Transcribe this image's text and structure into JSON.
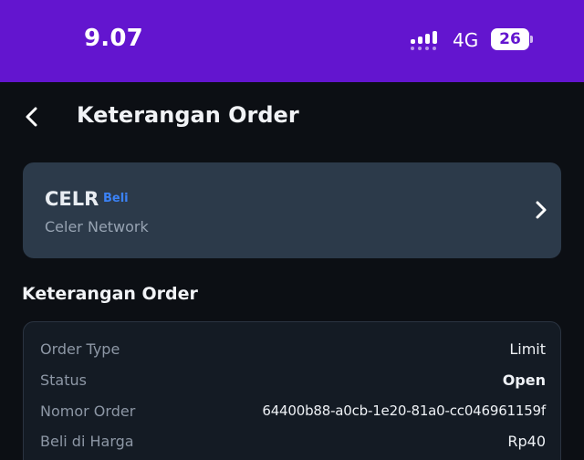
{
  "status_bar": {
    "time": "9.07",
    "network": "4G",
    "battery": "26",
    "background_color": "#6315cf"
  },
  "header": {
    "back_icon": "chevron-left-icon",
    "title": "Keterangan Order"
  },
  "asset": {
    "symbol": "CELR",
    "side": "Beli",
    "side_color": "#3b82f6",
    "name": "Celer Network",
    "chevron_icon": "chevron-right-icon"
  },
  "details": {
    "section_title": "Keterangan Order",
    "rows": [
      {
        "label": "Order Type",
        "value": "Limit"
      },
      {
        "label": "Status",
        "value": "Open"
      },
      {
        "label": "Nomor Order",
        "value": "64400b88-a0cb-1e20-81a0-cc046961159f"
      },
      {
        "label": "Beli di Harga",
        "value": "Rp40"
      }
    ]
  }
}
